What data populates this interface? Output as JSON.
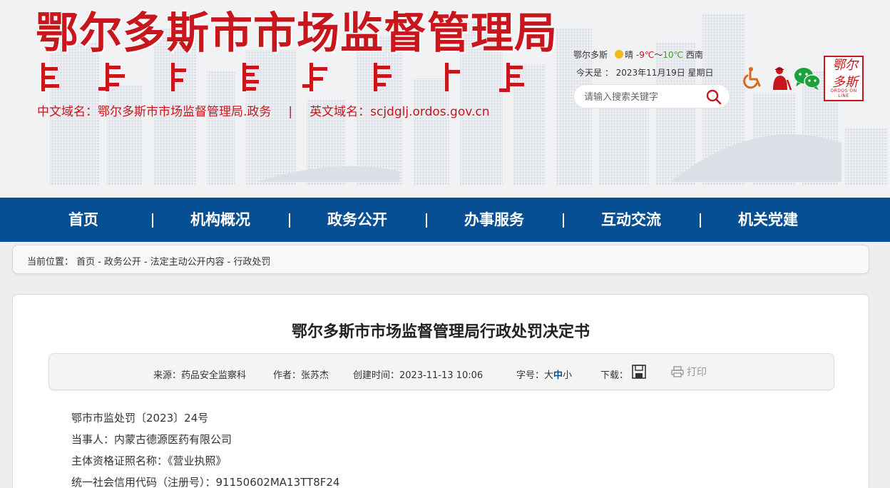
{
  "header": {
    "site_title": "鄂尔多斯市市场监督管理局",
    "domain_cn_label": "中文域名：鄂尔多斯市市场监督管理局.政务",
    "domain_sep": "|",
    "domain_en_label": "英文域名：scjdglj.ordos.gov.cn",
    "weather": {
      "city": "鄂尔多斯",
      "condition": "晴",
      "low": "-9℃",
      "range_sep": "～",
      "high": "10℃",
      "wind": "西南"
    },
    "date_line": "今天是 ： 2023年11月19日 星期日",
    "search_placeholder": "请输入搜索关键字",
    "logo_chars": "鄂尔\n多斯",
    "logo_sub": "ORDOS ON LINE"
  },
  "nav": {
    "items": [
      "首页",
      "机构概况",
      "政务公开",
      "办事服务",
      "互动交流",
      "机关党建"
    ],
    "sep": "|"
  },
  "breadcrumb": {
    "label": "当前位置：",
    "items": [
      "首页",
      "政务公开",
      "法定主动公开内容",
      "行政处罚"
    ],
    "sep": "-"
  },
  "article": {
    "title": "鄂尔多斯市市场监督管理局行政处罚决定书",
    "meta": {
      "source": "来源：药品安全监察科",
      "author": "作者：张苏杰",
      "created": "创建时间：2023-11-13 10:06",
      "fontsize_label": "字号：",
      "fontsize_large": "大",
      "fontsize_medium": "中",
      "fontsize_small": "小",
      "download_label": "下载：",
      "print_label": "打印"
    },
    "lines": [
      "鄂市市监处罚〔2023〕24号",
      "当事人：内蒙古德源医药有限公司",
      "主体资格证照名称：《营业执照》",
      "统一社会信用代码（注册号）：91150602MA13TT8F24"
    ]
  },
  "colors": {
    "brand_red": "#c8161d",
    "nav_blue": "#064f93",
    "font_medium_highlight": "#064f93"
  }
}
